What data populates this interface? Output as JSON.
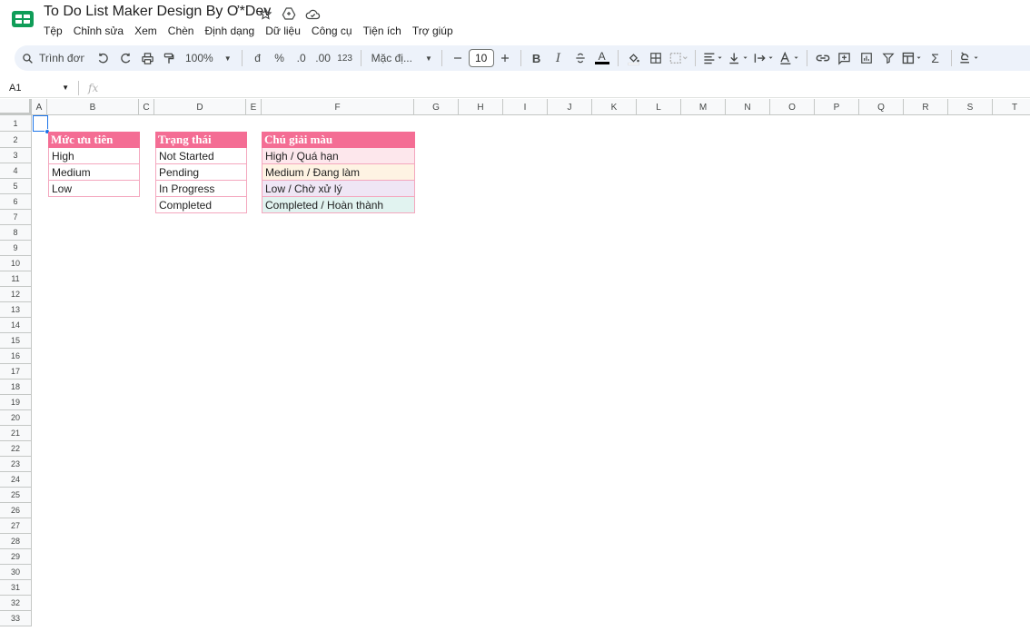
{
  "document": {
    "title": "To Do List Maker Design By Ơ*Dev"
  },
  "menu": [
    "Tệp",
    "Chỉnh sửa",
    "Xem",
    "Chèn",
    "Định dạng",
    "Dữ liệu",
    "Công cụ",
    "Tiện ích",
    "Trợ giúp"
  ],
  "toolbar": {
    "search_placeholder": "Trình đơn",
    "zoom": "100%",
    "currency": "đ",
    "percent": "%",
    "decrease_decimal": ".0",
    "increase_decimal": ".00",
    "number_format": "123",
    "font": "Mặc đị...",
    "font_size": "10",
    "bold": "B",
    "italic": "I",
    "text_color_letter": "A",
    "sum": "Σ"
  },
  "formula_bar": {
    "cell_ref": "A1",
    "fx": "fx",
    "value": ""
  },
  "columns": [
    "A",
    "B",
    "C",
    "D",
    "E",
    "F",
    "G",
    "H",
    "I",
    "J",
    "K",
    "L",
    "M",
    "N",
    "O",
    "P",
    "Q",
    "R",
    "S",
    "T"
  ],
  "rows": [
    "1",
    "2",
    "3",
    "4",
    "5",
    "6",
    "7",
    "8",
    "9",
    "10",
    "11",
    "12",
    "13",
    "14",
    "15",
    "16",
    "17",
    "18",
    "19",
    "20",
    "21",
    "22",
    "23",
    "24",
    "25",
    "26",
    "27",
    "28",
    "29",
    "30",
    "31",
    "32",
    "33"
  ],
  "tables": {
    "priority": {
      "header": "Mức ưu tiên",
      "items": [
        "High",
        "Medium",
        "Low"
      ]
    },
    "status": {
      "header": "Trạng thái",
      "items": [
        "Not Started",
        "Pending",
        "In Progress",
        "Completed"
      ]
    },
    "legend": {
      "header": "Chú giải màu",
      "items": [
        {
          "label": "High / Quá hạn",
          "color": "#fde7ec"
        },
        {
          "label": "Medium / Đang làm",
          "color": "#fef3e3"
        },
        {
          "label": "Low / Chờ xử lý",
          "color": "#efe6f5"
        },
        {
          "label": "Completed / Hoàn thành",
          "color": "#e1f3f0"
        }
      ]
    }
  },
  "colors": {
    "header_pink": "#f46d94",
    "border_pink": "#f4a7be",
    "selection_blue": "#1a73e8"
  }
}
